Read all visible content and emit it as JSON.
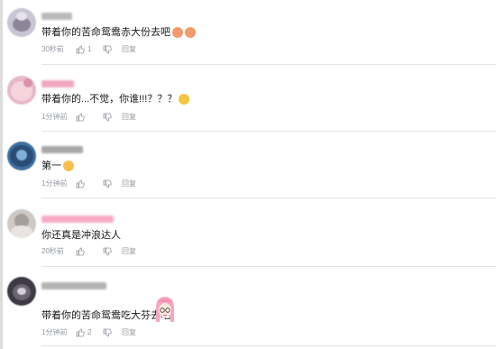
{
  "comments": [
    {
      "text": "带着你的苦命鸳鸯赤大份去吧",
      "emojis": [
        "smiling-face-emoji",
        "smiling-face-emoji"
      ],
      "time": "30秒前",
      "likes": "1",
      "reply_label": "回复",
      "avatar_color": "#c9c5d4",
      "name_color": "#a3a3a3"
    },
    {
      "text": "带着你的...不觉，你谁!!!？？？",
      "emojis": [
        "sweat-face-emoji"
      ],
      "time": "1分钟前",
      "likes": "",
      "reply_label": "回复",
      "avatar_color": "#e7b8c8",
      "name_color": "#ec8aa8"
    },
    {
      "text": "第一",
      "emojis": [
        "cat-face-emoji"
      ],
      "time": "1分钟前",
      "likes": "",
      "reply_label": "回复",
      "avatar_color": "#3c6ea0",
      "name_color": "#8a8a8a"
    },
    {
      "text": "你还真是冲浪达人",
      "emojis": [],
      "time": "20秒前",
      "likes": "",
      "reply_label": "回复",
      "avatar_color": "#cfc9c6",
      "name_color": "#f28fb0"
    },
    {
      "text": "带着你的苦命鸳鸯吃大芬去吧",
      "emojis": [],
      "time": "1分钟前",
      "likes": "2",
      "reply_label": "回复",
      "avatar_color": "#3d3a44",
      "name_color": "#9a9a9a"
    }
  ],
  "sticker": "anime-girl-sticker"
}
